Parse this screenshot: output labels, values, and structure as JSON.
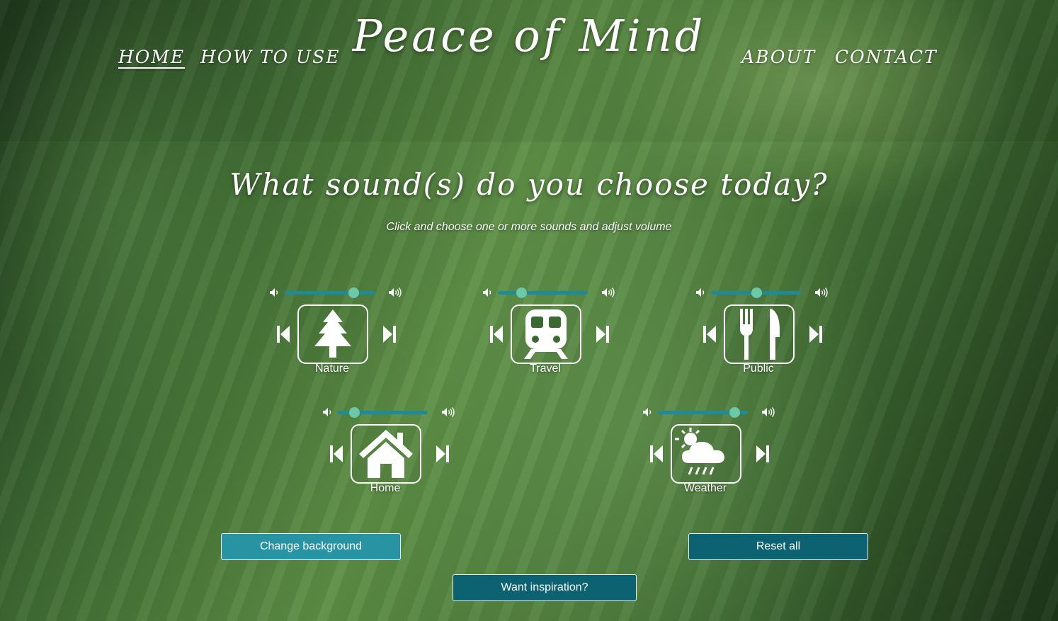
{
  "nav": {
    "home": "Home",
    "how_to_use": "How to use",
    "about": "About",
    "contact": "Contact"
  },
  "site_title": "Peace of Mind",
  "main": {
    "heading": "What sound(s) do you choose today?",
    "subheading": "Click and choose one or more sounds and adjust volume"
  },
  "sounds": [
    {
      "label": "Nature",
      "icon": "tree-icon",
      "volume": 0.76
    },
    {
      "label": "Travel",
      "icon": "train-icon",
      "volume": 0.26
    },
    {
      "label": "Public",
      "icon": "fork-knife-icon",
      "volume": 0.5
    },
    {
      "label": "Home",
      "icon": "house-icon",
      "volume": 0.18
    },
    {
      "label": "Weather",
      "icon": "weather-icon",
      "volume": 0.85
    }
  ],
  "buttons": {
    "change_background": "Change background",
    "reset_all": "Reset all",
    "want_inspiration": "Want inspiration?"
  },
  "colors": {
    "slider_track": "#1f8a9a",
    "slider_thumb": "#6cc9a8",
    "button_light": "#2793a3",
    "button_dark": "#0c6270"
  }
}
